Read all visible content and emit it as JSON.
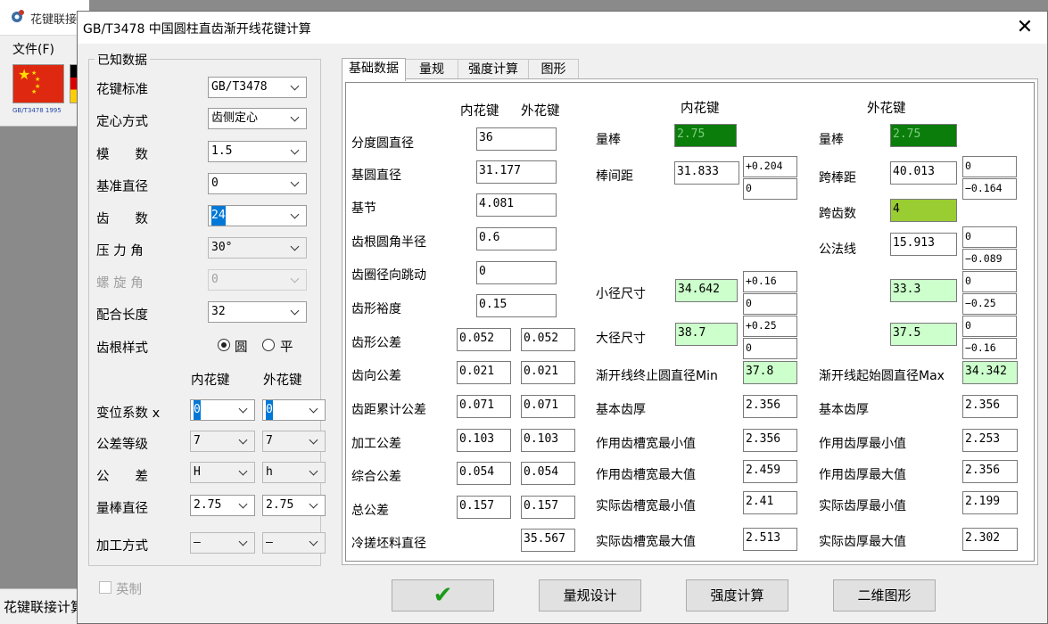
{
  "background_app": {
    "title": "花键联接",
    "menu_file": "文件(F)",
    "flag_caption": "GB/T3478 1995",
    "status_text": "花键联接计算"
  },
  "dialog": {
    "title": "GB/T3478 中国圆柱直齿渐开线花键计算",
    "close": "✕"
  },
  "known": {
    "group_title": "已知数据",
    "standard": {
      "label": "花键标准",
      "value": "GB/T3478"
    },
    "centering": {
      "label": "定心方式",
      "value": "齿侧定心"
    },
    "module": {
      "label": "模　　数",
      "value": "1.5"
    },
    "ref_dia": {
      "label": "基准直径",
      "value": "0"
    },
    "teeth": {
      "label": "齿　　数",
      "value": "24"
    },
    "pressure_angle": {
      "label": "压 力 角",
      "value": "30°"
    },
    "helix_angle": {
      "label": "螺 旋 角",
      "value": "0"
    },
    "fit_length": {
      "label": "配合长度",
      "value": "32"
    },
    "root_style": {
      "label": "齿根样式",
      "opt_round": "圆",
      "opt_flat": "平"
    },
    "col_internal": "内花键",
    "col_external": "外花键",
    "shift": {
      "label": "变位系数 x",
      "internal": "0",
      "external": "0"
    },
    "tol_grade": {
      "label": "公差等级",
      "internal": "7",
      "external": "7"
    },
    "tolerance": {
      "label": "公　　差",
      "internal": "H",
      "external": "h"
    },
    "pin_dia": {
      "label": "量棒直径",
      "internal": "2.75",
      "external": "2.75"
    },
    "process": {
      "label": "加工方式",
      "internal": "–",
      "external": "–"
    },
    "imperial": "英制"
  },
  "tabs": [
    "基础数据",
    "量规",
    "强度计算",
    "图形"
  ],
  "basic": {
    "head_internal": "内花键",
    "head_external": "外花键",
    "pitch_dia": {
      "label": "分度圆直径",
      "value": "36"
    },
    "base_dia": {
      "label": "基圆直径",
      "value": "31.177"
    },
    "base_pitch": {
      "label": "基节",
      "value": "4.081"
    },
    "root_fillet": {
      "label": "齿根圆角半径",
      "value": "0.6"
    },
    "runout": {
      "label": "齿圈径向跳动",
      "value": "0"
    },
    "form_clearance": {
      "label": "齿形裕度",
      "value": "0.15"
    },
    "profile_tol": {
      "label": "齿形公差",
      "internal": "0.052",
      "external": "0.052"
    },
    "lead_tol": {
      "label": "齿向公差",
      "internal": "0.021",
      "external": "0.021"
    },
    "cum_pitch_tol": {
      "label": "齿距累计公差",
      "internal": "0.071",
      "external": "0.071"
    },
    "machining_tol": {
      "label": "加工公差",
      "internal": "0.103",
      "external": "0.103"
    },
    "composite_tol": {
      "label": "综合公差",
      "internal": "0.054",
      "external": "0.054"
    },
    "total_tol": {
      "label": "总公差",
      "internal": "0.157",
      "external": "0.157"
    },
    "blank_dia": {
      "label": "冷搓坯料直径",
      "external": "35.567"
    }
  },
  "internal_spline": {
    "title": "内花键",
    "pin": {
      "label": "量棒",
      "value": "2.75"
    },
    "between_pins": {
      "label": "棒间距",
      "value": "31.833",
      "upper": "+0.204",
      "lower": "0"
    },
    "minor_dia": {
      "label": "小径尺寸",
      "value": "34.642",
      "upper": "+0.16",
      "lower": "0"
    },
    "major_dia": {
      "label": "大径尺寸",
      "value": "38.7",
      "upper": "+0.25",
      "lower": "0"
    },
    "form_end_dia": {
      "label": "渐开线终止圆直径Min",
      "value": "37.8"
    },
    "basic_space": {
      "label": "基本齿厚",
      "value": "2.356"
    },
    "eff_space_min": {
      "label": "作用齿槽宽最小值",
      "value": "2.356"
    },
    "eff_space_max": {
      "label": "作用齿槽宽最大值",
      "value": "2.459"
    },
    "act_space_min": {
      "label": "实际齿槽宽最小值",
      "value": "2.41"
    },
    "act_space_max": {
      "label": "实际齿槽宽最大值",
      "value": "2.513"
    }
  },
  "external_spline": {
    "title": "外花键",
    "pin": {
      "label": "量棒",
      "value": "2.75"
    },
    "over_pins": {
      "label": "跨棒距",
      "value": "40.013",
      "upper": "0",
      "lower": "−0.164"
    },
    "span_teeth": {
      "label": "跨齿数",
      "value": "4"
    },
    "common_normal": {
      "label": "公法线",
      "value": "15.913",
      "upper": "0",
      "lower": "−0.089"
    },
    "minor_dia": {
      "value": "33.3",
      "upper": "0",
      "lower": "−0.25"
    },
    "major_dia": {
      "value": "37.5",
      "upper": "0",
      "lower": "−0.16"
    },
    "form_start_dia": {
      "label": "渐开线起始圆直径Max",
      "value": "34.342"
    },
    "basic_thickness": {
      "label": "基本齿厚",
      "value": "2.356"
    },
    "eff_thick_min": {
      "label": "作用齿厚最小值",
      "value": "2.253"
    },
    "eff_thick_max": {
      "label": "作用齿厚最大值",
      "value": "2.356"
    },
    "act_thick_min": {
      "label": "实际齿厚最小值",
      "value": "2.199"
    },
    "act_thick_max": {
      "label": "实际齿厚最大值",
      "value": "2.302"
    }
  },
  "buttons": {
    "ok": "✔",
    "gauge": "量规设计",
    "strength": "强度计算",
    "drawing": "二维图形"
  },
  "colors": {
    "pin_box": "#0a7d0a",
    "span_box": "#9acd32",
    "result_box": "#ccffcc",
    "ok_check": "#1a9a1a",
    "selection": "#0078d7"
  }
}
